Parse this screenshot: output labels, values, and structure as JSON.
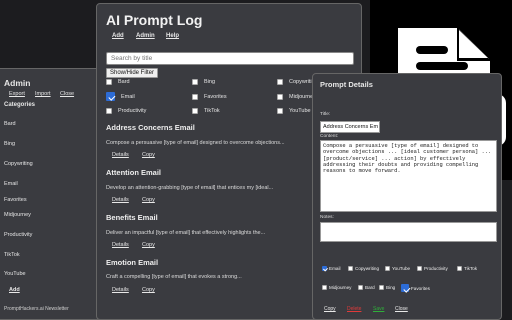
{
  "admin": {
    "title": "Admin",
    "nav": [
      "Export",
      "Import",
      "Close"
    ],
    "categories_label": "Categories",
    "categories": [
      "Bard",
      "Bing",
      "Copywriting",
      "Email",
      "Favorites",
      "Midjourney",
      "Productivity",
      "TikTok",
      "YouTube"
    ],
    "add_label": "Add",
    "newsletter": "PromptHackers.ai Newsletter"
  },
  "log": {
    "title": "AI Prompt Log",
    "nav": [
      "Add",
      "Admin",
      "Help"
    ],
    "search_placeholder": "Search by title",
    "filter_button": "Show/Hide Filter",
    "filters": [
      {
        "label": "Bard",
        "checked": false
      },
      {
        "label": "Bing",
        "checked": false
      },
      {
        "label": "Copywriting",
        "checked": false
      },
      {
        "label": "Email",
        "checked": true
      },
      {
        "label": "Favorites",
        "checked": false
      },
      {
        "label": "Midjourney",
        "checked": false
      },
      {
        "label": "Productivity",
        "checked": false
      },
      {
        "label": "TikTok",
        "checked": false
      },
      {
        "label": "YouTube",
        "checked": false
      }
    ],
    "entries": [
      {
        "title": "Address Concerns Email",
        "desc": "Compose a persuasive [type of email] designed to overcome objections..."
      },
      {
        "title": "Attention Email",
        "desc": "Develop an attention-grabbing [type of email] that entices my [ideal..."
      },
      {
        "title": "Benefits Email",
        "desc": "Deliver an impactful [type of email] that effectively highlights the..."
      },
      {
        "title": "Emotion Email",
        "desc": "Craft a compelling [type of email] that evokes a strong..."
      }
    ],
    "details_label": "Details",
    "copy_label": "Copy"
  },
  "details": {
    "title": "Prompt Details",
    "title_label": "Title:",
    "title_value": "Address Concerns Em",
    "content_label": "Content:",
    "content_value": "Compose a persuasive [type of email] designed to overcome objections ... [ideal customer persona] ... [product/service] ... action] by effectively addressing their doubts and providing compelling reasons to move forward.",
    "notes_label": "Notes:",
    "tags_row1": [
      {
        "label": "Email",
        "checked": true
      },
      {
        "label": "Copywriting",
        "checked": false
      },
      {
        "label": "YouTube",
        "checked": false
      },
      {
        "label": "Productivity",
        "checked": false
      },
      {
        "label": "TikTok",
        "checked": false
      }
    ],
    "tags_row2": [
      {
        "label": "Midjourney",
        "checked": false
      },
      {
        "label": "Bard",
        "checked": false
      },
      {
        "label": "Bing",
        "checked": false
      },
      {
        "label": "Favorites",
        "checked": true
      }
    ],
    "actions": [
      {
        "label": "Copy",
        "color": "#e8e8e8"
      },
      {
        "label": "Delete",
        "color": "#e03a3a"
      },
      {
        "label": "Save",
        "color": "#2fae3a"
      },
      {
        "label": "Close",
        "color": "#e8e8e8"
      }
    ]
  },
  "app_icon": {
    "text": "AI",
    "icon": "document-ai-icon"
  },
  "colors": {
    "panel": "#3a3b40",
    "background": "#1c1c1f",
    "accent": "#2d6cd6"
  }
}
